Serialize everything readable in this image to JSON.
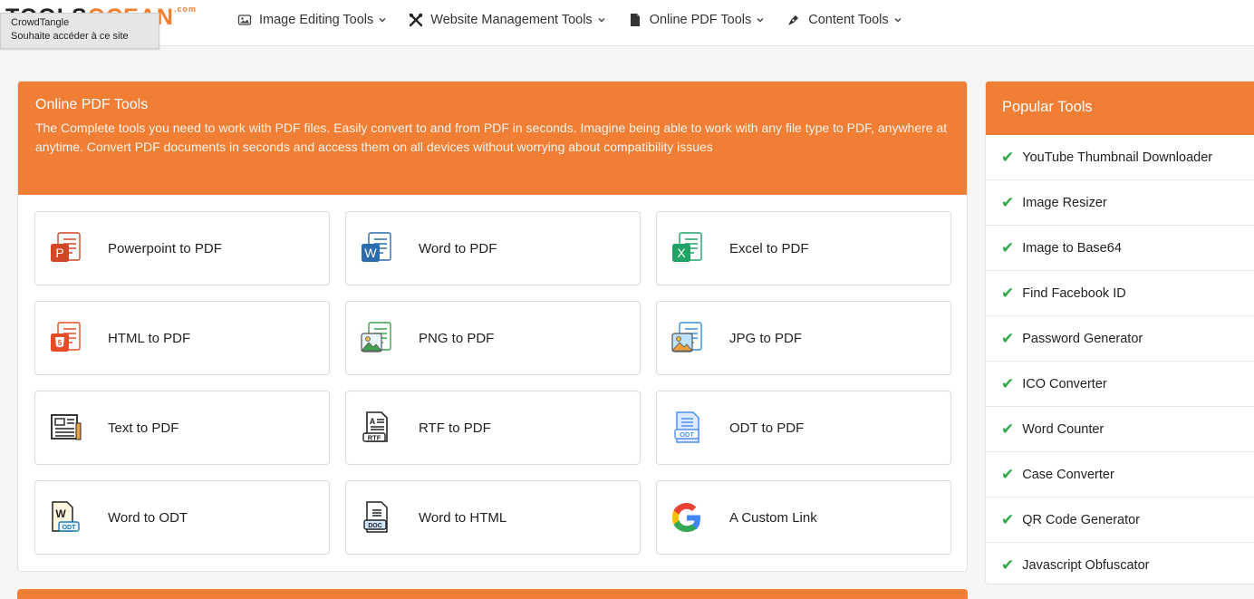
{
  "logo": {
    "text_dark": "TOOLS",
    "text_accent": "OCEAN",
    "text_suffix": ".com"
  },
  "tooltip": {
    "line1": "CrowdTangle",
    "line2": "Souhaite accéder à ce site"
  },
  "nav": [
    {
      "label": "Image Editing Tools",
      "icon": "image-icon"
    },
    {
      "label": "Website Management Tools",
      "icon": "tools-icon"
    },
    {
      "label": "Online PDF Tools",
      "icon": "file-icon"
    },
    {
      "label": "Content Tools",
      "icon": "pen-icon"
    }
  ],
  "main": {
    "title": "Online PDF Tools",
    "description": "The Complete tools you need to work with PDF files. Easily convert to and from PDF in seconds. Imagine being able to work with any file type to PDF, anywhere at anytime. Convert PDF documents in seconds and access them on all devices without worrying about compatibility issues",
    "tools": [
      {
        "label": "Powerpoint to PDF",
        "icon": "powerpoint-icon",
        "color": "#d24726"
      },
      {
        "label": "Word to PDF",
        "icon": "word-icon",
        "color": "#2b6cb0"
      },
      {
        "label": "Excel to PDF",
        "icon": "excel-icon",
        "color": "#21a366"
      },
      {
        "label": "HTML to PDF",
        "icon": "html5-icon",
        "color": "#e44d26"
      },
      {
        "label": "PNG to PDF",
        "icon": "png-image-icon",
        "color": "#3fa14b"
      },
      {
        "label": "JPG to PDF",
        "icon": "jpg-image-icon",
        "color": "#3b8fd9"
      },
      {
        "label": "Text to PDF",
        "icon": "text-document-icon",
        "color": "#e8a33b"
      },
      {
        "label": "RTF to PDF",
        "icon": "rtf-document-icon",
        "color": "#2c3e50"
      },
      {
        "label": "ODT to PDF",
        "icon": "odt-document-icon",
        "color": "#4f8ff0"
      },
      {
        "label": "Word to ODT",
        "icon": "word-odt-icon",
        "color": "#1f7ab8"
      },
      {
        "label": "Word to HTML",
        "icon": "doc-html-icon",
        "color": "#2c6ea5"
      },
      {
        "label": "A Custom Link",
        "icon": "google-icon",
        "color": "#4285f4"
      }
    ]
  },
  "sidebar": {
    "title": "Popular Tools",
    "items": [
      "YouTube Thumbnail Downloader",
      "Image Resizer",
      "Image to Base64",
      "Find Facebook ID",
      "Password Generator",
      "ICO Converter",
      "Word Counter",
      "Case Converter",
      "QR Code Generator",
      "Javascript Obfuscator"
    ]
  },
  "colors": {
    "accent": "#f07f35",
    "check": "#2ea84a"
  }
}
